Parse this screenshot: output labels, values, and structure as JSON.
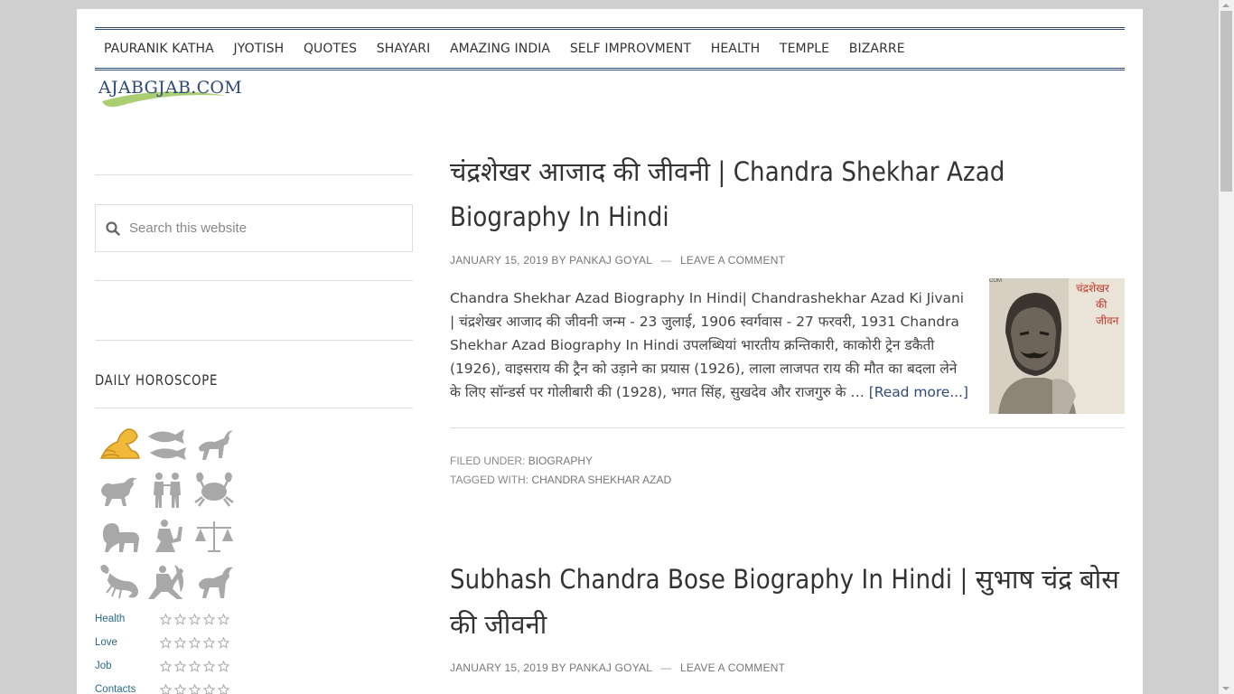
{
  "nav": {
    "items": [
      "PAURANIK KATHA",
      "JYOTISH",
      "QUOTES",
      "SHAYARI",
      "AMAZING INDIA",
      "SELF IMPROVMENT",
      "HEALTH",
      "TEMPLE",
      "BIZARRE"
    ]
  },
  "logo": {
    "text": "AJABGJAB.COM"
  },
  "sidebar": {
    "search_placeholder": "Search this website",
    "horoscope_title": "DAILY HOROSCOPE",
    "zodiac_icons": [
      "aquarius-icon",
      "pisces-icon",
      "aries-icon",
      "taurus-icon",
      "gemini-icon",
      "cancer-icon",
      "leo-icon",
      "virgo-icon",
      "libra-icon",
      "scorpio-icon",
      "sagittarius-icon",
      "capricorn-icon"
    ],
    "ratings": [
      {
        "label": "Health",
        "stars": 0
      },
      {
        "label": "Love",
        "stars": 0
      },
      {
        "label": "Job",
        "stars": 0
      },
      {
        "label": "Contacts",
        "stars": 0
      }
    ]
  },
  "posts": [
    {
      "title": "चंद्रशेखर आजाद की जीवनी | Chandra Shekhar Azad Biography In Hindi",
      "date": "JANUARY 15, 2019",
      "by": "BY",
      "author": "PANKAJ GOYAL",
      "comment": "LEAVE A COMMENT",
      "excerpt": "Chandra Shekhar Azad Biography In Hindi| Chandrashekhar Azad Ki Jivani | चंद्रशेखर आजाद की जीवनी जन्म - 23 जुलाई, 1906 स्वर्गवास - 27 फरवरी, 1931 Chandra Shekhar Azad Biography In Hindi उपलब्धियां भारतीय क्रन्तिकारी, काकोरी ट्रेन डकैती (1926), वाइसराय की ट्रैन को उड़ाने का प्रयास (1926), लाला लाजपत राय की मौत का बदला लेने के लिए सॉन्डर्स पर गोलीबारी की (1928), भगत सिंह, सुखदेव और राजगुरु के … ",
      "read_more": "[Read more...]",
      "thumb_text": [
        "चंद्रशेखर",
        "की",
        "जीवन"
      ],
      "thumb_corner": "COM",
      "filed_label": "FILED UNDER:",
      "filed_value": "BIOGRAPHY",
      "tagged_label": "TAGGED WITH:",
      "tagged_value": "CHANDRA SHEKHAR AZAD"
    },
    {
      "title": "Subhash Chandra Bose Biography In Hindi | सुभाष चंद्र बोस की जीवनी",
      "date": "JANUARY 15, 2019",
      "by": "BY",
      "author": "PANKAJ GOYAL",
      "comment": "LEAVE A COMMENT"
    }
  ],
  "colors": {
    "nav_border": "#2e4a7a",
    "link": "#2e4a7a",
    "sidebar_link": "#2a6a86",
    "active_sign": "#f0b93a"
  }
}
